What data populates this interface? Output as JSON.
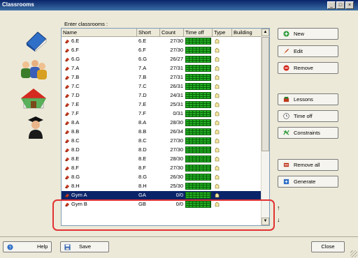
{
  "window": {
    "title": "Classrooms"
  },
  "titlebar_buttons": {
    "minimize": "_",
    "maximize": "□",
    "close": "×"
  },
  "list_label": "Enter classrooms :",
  "columns": [
    "Name",
    "Short",
    "Count",
    "Time off",
    "Type",
    "Building"
  ],
  "rows": [
    {
      "name": "6.E",
      "short": "6.E",
      "count": "27/30"
    },
    {
      "name": "6.F",
      "short": "6.F",
      "count": "27/30"
    },
    {
      "name": "6.G",
      "short": "6.G",
      "count": "26/27"
    },
    {
      "name": "7.A",
      "short": "7.A",
      "count": "27/31"
    },
    {
      "name": "7.B",
      "short": "7.B",
      "count": "27/31"
    },
    {
      "name": "7.C",
      "short": "7.C",
      "count": "26/31"
    },
    {
      "name": "7.D",
      "short": "7.D",
      "count": "24/31"
    },
    {
      "name": "7.E",
      "short": "7.E",
      "count": "25/31"
    },
    {
      "name": "7.F",
      "short": "7.F",
      "count": "0/31"
    },
    {
      "name": "8.A",
      "short": "8.A",
      "count": "28/30"
    },
    {
      "name": "8.B",
      "short": "8.B",
      "count": "26/34"
    },
    {
      "name": "8.C",
      "short": "8.C",
      "count": "27/30"
    },
    {
      "name": "8.D",
      "short": "8.D",
      "count": "27/30"
    },
    {
      "name": "8.E",
      "short": "8.E",
      "count": "28/30"
    },
    {
      "name": "8.F",
      "short": "8.F",
      "count": "27/30"
    },
    {
      "name": "8.G",
      "short": "8.G",
      "count": "26/30"
    },
    {
      "name": "8.H",
      "short": "8.H",
      "count": "25/30"
    },
    {
      "name": "Gym A",
      "short": "GA",
      "count": "0/0",
      "selected": true
    },
    {
      "name": "Gym B",
      "short": "GB",
      "count": "0/0"
    }
  ],
  "buttons": {
    "new": "New",
    "edit": "Edit",
    "remove": "Remove",
    "lessons": "Lessons",
    "time_off": "Time off",
    "constraints": "Constraints",
    "remove_all": "Remove all",
    "generate": "Generate"
  },
  "move": {
    "up": "↑",
    "down": "↓"
  },
  "footer": {
    "help": "Help",
    "save": "Save",
    "close": "Close"
  },
  "colors": {
    "selection": "#0a246a",
    "highlight": "#e23232",
    "timeoff_green": "#22b022"
  }
}
